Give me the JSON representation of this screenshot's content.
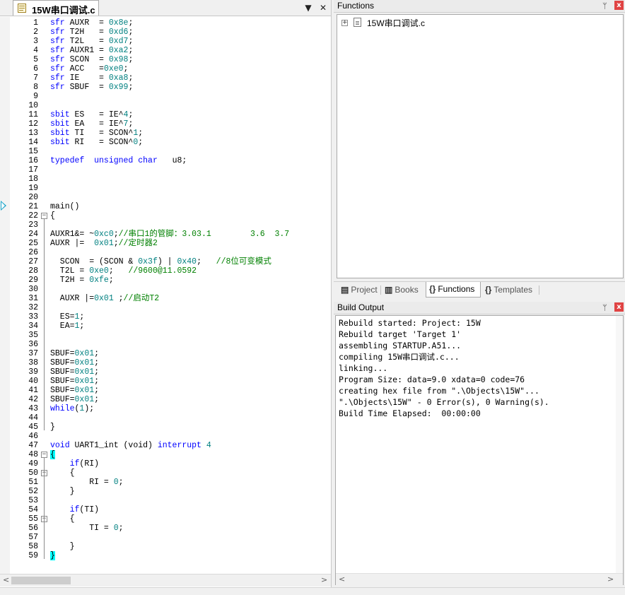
{
  "editor": {
    "tab_label": "15W串口调试.c",
    "dropdown_glyph": "▼",
    "close_glyph": "✕",
    "scroll_left": "<",
    "scroll_right": ">",
    "lines": [
      {
        "n": "1",
        "parts": [
          [
            "kw",
            "sfr"
          ],
          [
            "p",
            " AUXR  = "
          ],
          [
            "num",
            "0x8e"
          ],
          [
            "p",
            ";"
          ]
        ]
      },
      {
        "n": "2",
        "parts": [
          [
            "kw",
            "sfr"
          ],
          [
            "p",
            " T2H   = "
          ],
          [
            "num",
            "0xd6"
          ],
          [
            "p",
            ";"
          ]
        ]
      },
      {
        "n": "3",
        "parts": [
          [
            "kw",
            "sfr"
          ],
          [
            "p",
            " T2L   = "
          ],
          [
            "num",
            "0xd7"
          ],
          [
            "p",
            ";"
          ]
        ]
      },
      {
        "n": "4",
        "parts": [
          [
            "kw",
            "sfr"
          ],
          [
            "p",
            " AUXR1 = "
          ],
          [
            "num",
            "0xa2"
          ],
          [
            "p",
            ";"
          ]
        ]
      },
      {
        "n": "5",
        "parts": [
          [
            "kw",
            "sfr"
          ],
          [
            "p",
            " SCON  = "
          ],
          [
            "num",
            "0x98"
          ],
          [
            "p",
            ";"
          ]
        ]
      },
      {
        "n": "6",
        "parts": [
          [
            "kw",
            "sfr"
          ],
          [
            "p",
            " ACC   ="
          ],
          [
            "num",
            "0xe0"
          ],
          [
            "p",
            ";"
          ]
        ]
      },
      {
        "n": "7",
        "parts": [
          [
            "kw",
            "sfr"
          ],
          [
            "p",
            " IE    = "
          ],
          [
            "num",
            "0xa8"
          ],
          [
            "p",
            ";"
          ]
        ]
      },
      {
        "n": "8",
        "parts": [
          [
            "kw",
            "sfr"
          ],
          [
            "p",
            " SBUF  = "
          ],
          [
            "num",
            "0x99"
          ],
          [
            "p",
            ";"
          ]
        ]
      },
      {
        "n": "9",
        "parts": []
      },
      {
        "n": "10",
        "parts": []
      },
      {
        "n": "11",
        "parts": [
          [
            "kw",
            "sbit"
          ],
          [
            "p",
            " ES   = IE^"
          ],
          [
            "num",
            "4"
          ],
          [
            "p",
            ";"
          ]
        ]
      },
      {
        "n": "12",
        "parts": [
          [
            "kw",
            "sbit"
          ],
          [
            "p",
            " EA   = IE^"
          ],
          [
            "num",
            "7"
          ],
          [
            "p",
            ";"
          ]
        ]
      },
      {
        "n": "13",
        "parts": [
          [
            "kw",
            "sbit"
          ],
          [
            "p",
            " TI   = SCON^"
          ],
          [
            "num",
            "1"
          ],
          [
            "p",
            ";"
          ]
        ]
      },
      {
        "n": "14",
        "parts": [
          [
            "kw",
            "sbit"
          ],
          [
            "p",
            " RI   = SCON^"
          ],
          [
            "num",
            "0"
          ],
          [
            "p",
            ";"
          ]
        ]
      },
      {
        "n": "15",
        "parts": []
      },
      {
        "n": "16",
        "parts": [
          [
            "kw",
            "typedef"
          ],
          [
            "p",
            "  "
          ],
          [
            "kw",
            "unsigned"
          ],
          [
            "p",
            " "
          ],
          [
            "kw",
            "char"
          ],
          [
            "p",
            "   u8;"
          ]
        ]
      },
      {
        "n": "17",
        "parts": []
      },
      {
        "n": "18",
        "parts": []
      },
      {
        "n": "19",
        "parts": []
      },
      {
        "n": "20",
        "parts": []
      },
      {
        "n": "21",
        "parts": [
          [
            "p",
            "main()"
          ]
        ]
      },
      {
        "n": "22",
        "fold": "−",
        "parts": [
          [
            "p",
            "{"
          ]
        ]
      },
      {
        "n": "23",
        "parts": []
      },
      {
        "n": "24",
        "parts": [
          [
            "p",
            "AUXR1&= ~"
          ],
          [
            "num",
            "0xc0"
          ],
          [
            "p",
            ";"
          ],
          [
            "cmt",
            "//串口1的管脚：3.03.1        3.6  3.7"
          ]
        ]
      },
      {
        "n": "25",
        "parts": [
          [
            "p",
            "AUXR |=  "
          ],
          [
            "num",
            "0x01"
          ],
          [
            "p",
            ";"
          ],
          [
            "cmt",
            "//定时器2"
          ]
        ]
      },
      {
        "n": "26",
        "parts": []
      },
      {
        "n": "27",
        "parts": [
          [
            "p",
            "  SCON  = (SCON & "
          ],
          [
            "num",
            "0x3f"
          ],
          [
            "p",
            ") | "
          ],
          [
            "num",
            "0x40"
          ],
          [
            "p",
            ";   "
          ],
          [
            "cmt",
            "//8位可变模式"
          ]
        ]
      },
      {
        "n": "28",
        "parts": [
          [
            "p",
            "  T2L = "
          ],
          [
            "num",
            "0xe0"
          ],
          [
            "p",
            ";   "
          ],
          [
            "cmt",
            "//9600@11.0592"
          ]
        ]
      },
      {
        "n": "29",
        "parts": [
          [
            "p",
            "  T2H = "
          ],
          [
            "num",
            "0xfe"
          ],
          [
            "p",
            ";"
          ]
        ]
      },
      {
        "n": "30",
        "parts": []
      },
      {
        "n": "31",
        "parts": [
          [
            "p",
            "  AUXR |="
          ],
          [
            "num",
            "0x01"
          ],
          [
            "p",
            " ;"
          ],
          [
            "cmt",
            "//启动T2"
          ]
        ]
      },
      {
        "n": "32",
        "parts": []
      },
      {
        "n": "33",
        "parts": [
          [
            "p",
            "  ES="
          ],
          [
            "num",
            "1"
          ],
          [
            "p",
            ";"
          ]
        ]
      },
      {
        "n": "34",
        "parts": [
          [
            "p",
            "  EA="
          ],
          [
            "num",
            "1"
          ],
          [
            "p",
            ";"
          ]
        ]
      },
      {
        "n": "35",
        "parts": []
      },
      {
        "n": "36",
        "parts": []
      },
      {
        "n": "37",
        "parts": [
          [
            "p",
            "SBUF="
          ],
          [
            "num",
            "0x01"
          ],
          [
            "p",
            ";"
          ]
        ]
      },
      {
        "n": "38",
        "parts": [
          [
            "p",
            "SBUF="
          ],
          [
            "num",
            "0x01"
          ],
          [
            "p",
            ";"
          ]
        ]
      },
      {
        "n": "39",
        "parts": [
          [
            "p",
            "SBUF="
          ],
          [
            "num",
            "0x01"
          ],
          [
            "p",
            ";"
          ]
        ]
      },
      {
        "n": "40",
        "parts": [
          [
            "p",
            "SBUF="
          ],
          [
            "num",
            "0x01"
          ],
          [
            "p",
            ";"
          ]
        ]
      },
      {
        "n": "41",
        "parts": [
          [
            "p",
            "SBUF="
          ],
          [
            "num",
            "0x01"
          ],
          [
            "p",
            ";"
          ]
        ]
      },
      {
        "n": "42",
        "parts": [
          [
            "p",
            "SBUF="
          ],
          [
            "num",
            "0x01"
          ],
          [
            "p",
            ";"
          ]
        ]
      },
      {
        "n": "43",
        "parts": [
          [
            "kw",
            "while"
          ],
          [
            "p",
            "("
          ],
          [
            "num",
            "1"
          ],
          [
            "p",
            ");"
          ]
        ]
      },
      {
        "n": "44",
        "parts": []
      },
      {
        "n": "45",
        "parts": [
          [
            "p",
            "}"
          ]
        ]
      },
      {
        "n": "46",
        "parts": []
      },
      {
        "n": "47",
        "parts": [
          [
            "kw",
            "void"
          ],
          [
            "p",
            " UART1_int (void) "
          ],
          [
            "kw",
            "interrupt"
          ],
          [
            "p",
            " "
          ],
          [
            "num",
            "4"
          ]
        ]
      },
      {
        "n": "48",
        "fold": "−",
        "parts": [
          [
            "hl",
            "{"
          ]
        ]
      },
      {
        "n": "49",
        "parts": [
          [
            "p",
            "    "
          ],
          [
            "kw",
            "if"
          ],
          [
            "p",
            "(RI)"
          ]
        ]
      },
      {
        "n": "50",
        "fold": "−",
        "parts": [
          [
            "p",
            "    {"
          ]
        ]
      },
      {
        "n": "51",
        "parts": [
          [
            "p",
            "        RI = "
          ],
          [
            "num",
            "0"
          ],
          [
            "p",
            ";"
          ]
        ]
      },
      {
        "n": "52",
        "parts": [
          [
            "p",
            "    }"
          ]
        ]
      },
      {
        "n": "53",
        "parts": []
      },
      {
        "n": "54",
        "parts": [
          [
            "p",
            "    "
          ],
          [
            "kw",
            "if"
          ],
          [
            "p",
            "(TI)"
          ]
        ]
      },
      {
        "n": "55",
        "fold": "−",
        "parts": [
          [
            "p",
            "    {"
          ]
        ]
      },
      {
        "n": "56",
        "parts": [
          [
            "p",
            "        TI = "
          ],
          [
            "num",
            "0"
          ],
          [
            "p",
            ";"
          ]
        ]
      },
      {
        "n": "57",
        "parts": []
      },
      {
        "n": "58",
        "parts": [
          [
            "p",
            "    }"
          ]
        ]
      },
      {
        "n": "59",
        "parts": [
          [
            "hl",
            "}"
          ]
        ]
      }
    ]
  },
  "functions_panel": {
    "title": "Functions",
    "pin_glyph": "ᛘ",
    "close_glyph": "x",
    "tree_expander": "+",
    "tree_item": "15W串口调试.c"
  },
  "project_tabs": [
    {
      "icon": "▤",
      "label": "Project",
      "active": false
    },
    {
      "icon": "▥",
      "label": "Books",
      "active": false
    },
    {
      "icon": "{}",
      "label": "Functions",
      "active": true
    },
    {
      "icon": "{}",
      "label": "Templates",
      "active": false
    }
  ],
  "build_output": {
    "title": "Build Output",
    "pin_glyph": "ᛘ",
    "close_glyph": "x",
    "scroll_left": "<",
    "scroll_right": ">",
    "lines": [
      "Rebuild started: Project: 15W",
      "Rebuild target 'Target 1'",
      "assembling STARTUP.A51...",
      "compiling 15W串口调试.c...",
      "linking...",
      "Program Size: data=9.0 xdata=0 code=76",
      "creating hex file from \".\\Objects\\15W\"...",
      "\".\\Objects\\15W\" - 0 Error(s), 0 Warning(s).",
      "Build Time Elapsed:  00:00:00"
    ]
  },
  "colors": {
    "keyword": "#0000ff",
    "number": "#008080",
    "comment": "#008000",
    "brace_highlight": "#00ffff",
    "close_button": "#e04343"
  }
}
